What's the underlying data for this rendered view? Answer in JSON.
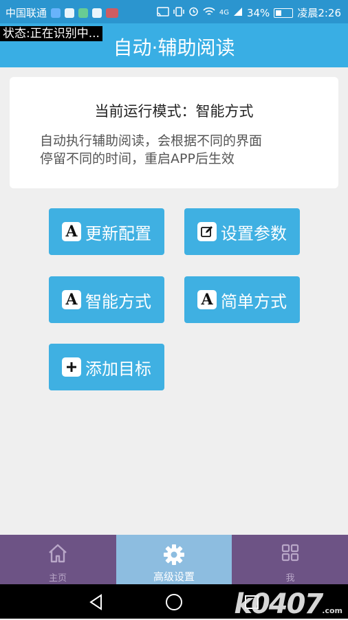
{
  "statusbar": {
    "carrier": "中国联通",
    "signal": "4G",
    "battery": "34%",
    "time": "凌晨2:26"
  },
  "overlay": {
    "status_text": "状态:正在识别中..."
  },
  "appbar": {
    "title": "自动·辅助阅读"
  },
  "card": {
    "title": "当前运行模式：智能方式",
    "desc_line1": "自动执行辅助阅读，会根据不同的界面",
    "desc_line2": "停留不同的时间，重启APP后生效"
  },
  "buttons": {
    "update_config": "更新配置",
    "set_params": "设置参数",
    "smart_mode": "智能方式",
    "simple_mode": "简单方式",
    "add_target": "添加目标",
    "letter_icon": "A"
  },
  "nav": {
    "home": "主页",
    "advanced": "高级设置",
    "me": "我"
  },
  "watermark": {
    "main": "k0407",
    "sub": ".com"
  },
  "colors": {
    "appbar": "#39aee4",
    "button": "#3fb0e2",
    "nav_bg": "#6d5385",
    "nav_active": "#8dbde0"
  }
}
